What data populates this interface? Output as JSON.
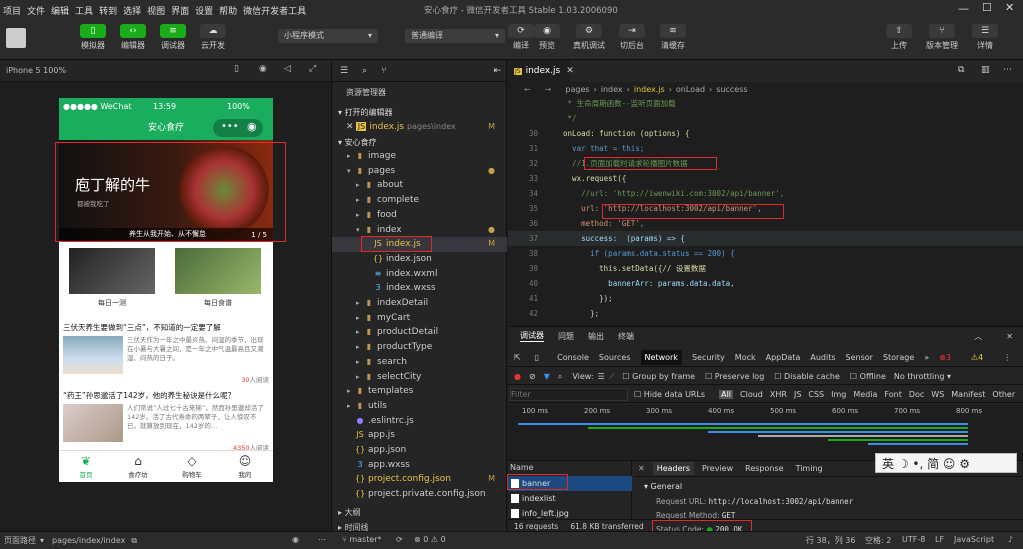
{
  "menu": [
    "项目",
    "文件",
    "编辑",
    "工具",
    "转到",
    "选择",
    "视图",
    "界面",
    "设置",
    "帮助",
    "微信开发者工具"
  ],
  "window_title": "安心食疗 - 微信开发者工具 Stable 1.03.2006090",
  "toolbar": {
    "left_buttons": [
      "模拟器",
      "编辑器",
      "调试器",
      "云开发"
    ],
    "mode_select": "小程序模式",
    "compile_select": "普通编译",
    "mid_buttons": [
      "编译",
      "预览",
      "真机调试",
      "切后台",
      "清缓存"
    ],
    "right_buttons": [
      "上传",
      "版本管理",
      "详情"
    ]
  },
  "simulator": {
    "device": "iPhone 5 100%",
    "status_carrier": "●●●●● WeChat",
    "status_time": "13:59",
    "status_battery": "100%",
    "nav_title": "安心食疗",
    "banner_title": "庖丁解的牛",
    "banner_sub": "都被我吃了",
    "banner_caption": "养生从我开始、从不懈怠",
    "banner_counter": "1 / 5",
    "grid": [
      "每日一测",
      "每日食谱"
    ],
    "articles": [
      {
        "title": "三伏天养生要做到“三点”，不知道的一定要了解",
        "desc": "三伏天作为一年之中最炎热、闷湿的季节，出现在小暑与大暑之间，是一年之中气温最高且又潮湿、闷热的日子。",
        "count": "30",
        "count_suffix": "人阅读"
      },
      {
        "title": "“药王”孙思邈活了142岁，他的养生秘诀是什么呢？",
        "desc": "人们常说“人过七十古来稀”，然而孙思邈却活了142岁。活了古代寿命的两辈子，让人惊叹不已。就算放到现在，142岁的…",
        "count": "4350",
        "count_suffix": "人阅读"
      }
    ],
    "tabs": [
      "首页",
      "食疗坊",
      "购物车",
      "我的"
    ]
  },
  "footer": {
    "path_label": "页面路径",
    "path": "pages/index/index",
    "branch": "master*",
    "errors": "⊗ 0 ⚠ 0",
    "cursor": "行 38，列 36",
    "indent": "空格: 2",
    "encoding": "UTF-8",
    "eol": "LF",
    "language": "JavaScript"
  },
  "explorer": {
    "header": "资源管理器",
    "open_editors": "打开的编辑器",
    "open_file": "index.js",
    "open_file_path": "pages\\index",
    "project": "安心食疗",
    "items": [
      {
        "name": "image",
        "depth": 1,
        "type": "folder",
        "arrow": "▸"
      },
      {
        "name": "pages",
        "depth": 1,
        "type": "folder",
        "arrow": "▾",
        "mark": "●"
      },
      {
        "name": "about",
        "depth": 2,
        "type": "folder",
        "arrow": "▸"
      },
      {
        "name": "complete",
        "depth": 2,
        "type": "folder",
        "arrow": "▸"
      },
      {
        "name": "food",
        "depth": 2,
        "type": "folder",
        "arrow": "▸"
      },
      {
        "name": "index",
        "depth": 2,
        "type": "folder",
        "arrow": "▾",
        "mark": "●"
      },
      {
        "name": "index.js",
        "depth": 3,
        "type": "js",
        "arrow": "",
        "mark": "M"
      },
      {
        "name": "index.json",
        "depth": 3,
        "type": "json",
        "arrow": ""
      },
      {
        "name": "index.wxml",
        "depth": 3,
        "type": "wxml",
        "arrow": ""
      },
      {
        "name": "index.wxss",
        "depth": 3,
        "type": "wxss",
        "arrow": ""
      },
      {
        "name": "indexDetail",
        "depth": 2,
        "type": "folder",
        "arrow": "▸"
      },
      {
        "name": "myCart",
        "depth": 2,
        "type": "folder",
        "arrow": "▸"
      },
      {
        "name": "productDetail",
        "depth": 2,
        "type": "folder",
        "arrow": "▸"
      },
      {
        "name": "productType",
        "depth": 2,
        "type": "folder",
        "arrow": "▸"
      },
      {
        "name": "search",
        "depth": 2,
        "type": "folder",
        "arrow": "▸"
      },
      {
        "name": "selectCity",
        "depth": 2,
        "type": "folder",
        "arrow": "▸"
      },
      {
        "name": "templates",
        "depth": 1,
        "type": "folder",
        "arrow": "▸"
      },
      {
        "name": "utils",
        "depth": 1,
        "type": "folder",
        "arrow": "▸"
      },
      {
        "name": ".eslintrc.js",
        "depth": 1,
        "type": "eslint",
        "arrow": ""
      },
      {
        "name": "app.js",
        "depth": 1,
        "type": "js",
        "arrow": ""
      },
      {
        "name": "app.json",
        "depth": 1,
        "type": "json",
        "arrow": ""
      },
      {
        "name": "app.wxss",
        "depth": 1,
        "type": "wxss",
        "arrow": ""
      },
      {
        "name": "project.config.json",
        "depth": 1,
        "type": "json",
        "arrow": "",
        "mark": "M"
      },
      {
        "name": "project.private.config.json",
        "depth": 1,
        "type": "json",
        "arrow": ""
      }
    ],
    "outline": "大纲",
    "timeline": "时间线"
  },
  "editor": {
    "tab": "index.js",
    "breadcrumb": [
      "pages",
      "index",
      "index.js",
      "onLoad",
      "success"
    ],
    "lines": [
      {
        "n": "",
        "t": "   * 生命周期函数--监听页面加载",
        "k": "cm"
      },
      {
        "n": "",
        "t": "   */",
        "k": "cm"
      },
      {
        "n": "30",
        "t": "  onLoad: function (options) {",
        "k": "fn"
      },
      {
        "n": "31",
        "t": "    var that = this;",
        "k": "kw"
      },
      {
        "n": "32",
        "t": "    //1.页面加载时请求轮播图片数据",
        "k": "cm"
      },
      {
        "n": "33",
        "t": "    wx.request({",
        "k": "fn"
      },
      {
        "n": "34",
        "t": "      //url: 'http://iwenwiki.com:3002/api/banner',",
        "k": "cm"
      },
      {
        "n": "35",
        "t": "      url: 'http://localhost:3002/api/banner',",
        "k": "str"
      },
      {
        "n": "36",
        "t": "      method: 'GET',",
        "k": "str"
      },
      {
        "n": "37",
        "t": "      success:  (params) => {",
        "k": "pr"
      },
      {
        "n": "38",
        "t": "        if (params.data.status == 200) {",
        "k": "kw"
      },
      {
        "n": "39",
        "t": "          this.setData({// 设置数据",
        "k": "fn"
      },
      {
        "n": "40",
        "t": "            bannerArr: params.data.data,",
        "k": "pr"
      },
      {
        "n": "41",
        "t": "          });",
        "k": ""
      },
      {
        "n": "42",
        "t": "        };",
        "k": ""
      }
    ]
  },
  "devtools": {
    "top_tabs": [
      "调试器",
      "问题",
      "输出",
      "终端"
    ],
    "tabs": [
      "Console",
      "Sources",
      "Network",
      "Security",
      "Mock",
      "AppData",
      "Audits",
      "Sensor",
      "Storage"
    ],
    "errors": "3",
    "warnings": "4",
    "view_label": "View:",
    "group_by_frame": "Group by frame",
    "preserve_log": "Preserve log",
    "disable_cache": "Disable cache",
    "offline": "Offline",
    "throttling": "No throttling",
    "filter_placeholder": "Filter",
    "hide_data_urls": "Hide data URLs",
    "types": [
      "All",
      "Cloud",
      "XHR",
      "JS",
      "CSS",
      "Img",
      "Media",
      "Font",
      "Doc",
      "WS",
      "Manifest",
      "Other"
    ],
    "ticks": [
      "100 ms",
      "200 ms",
      "300 ms",
      "400 ms",
      "500 ms",
      "600 ms",
      "700 ms",
      "800 ms"
    ],
    "name_header": "Name",
    "requests": [
      "banner",
      "indexlist",
      "info_left.jpg"
    ],
    "summary": "16 requests",
    "transferred": "61.8 KB transferred",
    "detail_tabs": [
      "Headers",
      "Preview",
      "Response",
      "Timing"
    ],
    "general": "▾ General",
    "request_url_label": "Request URL:",
    "request_url": "http://localhost:3002/api/banner",
    "method_label": "Request Method:",
    "method": "GET",
    "status_label": "Status Code:",
    "status": "200 OK",
    "ime": "英 ☽ •, 简 ☺ ⚙"
  }
}
